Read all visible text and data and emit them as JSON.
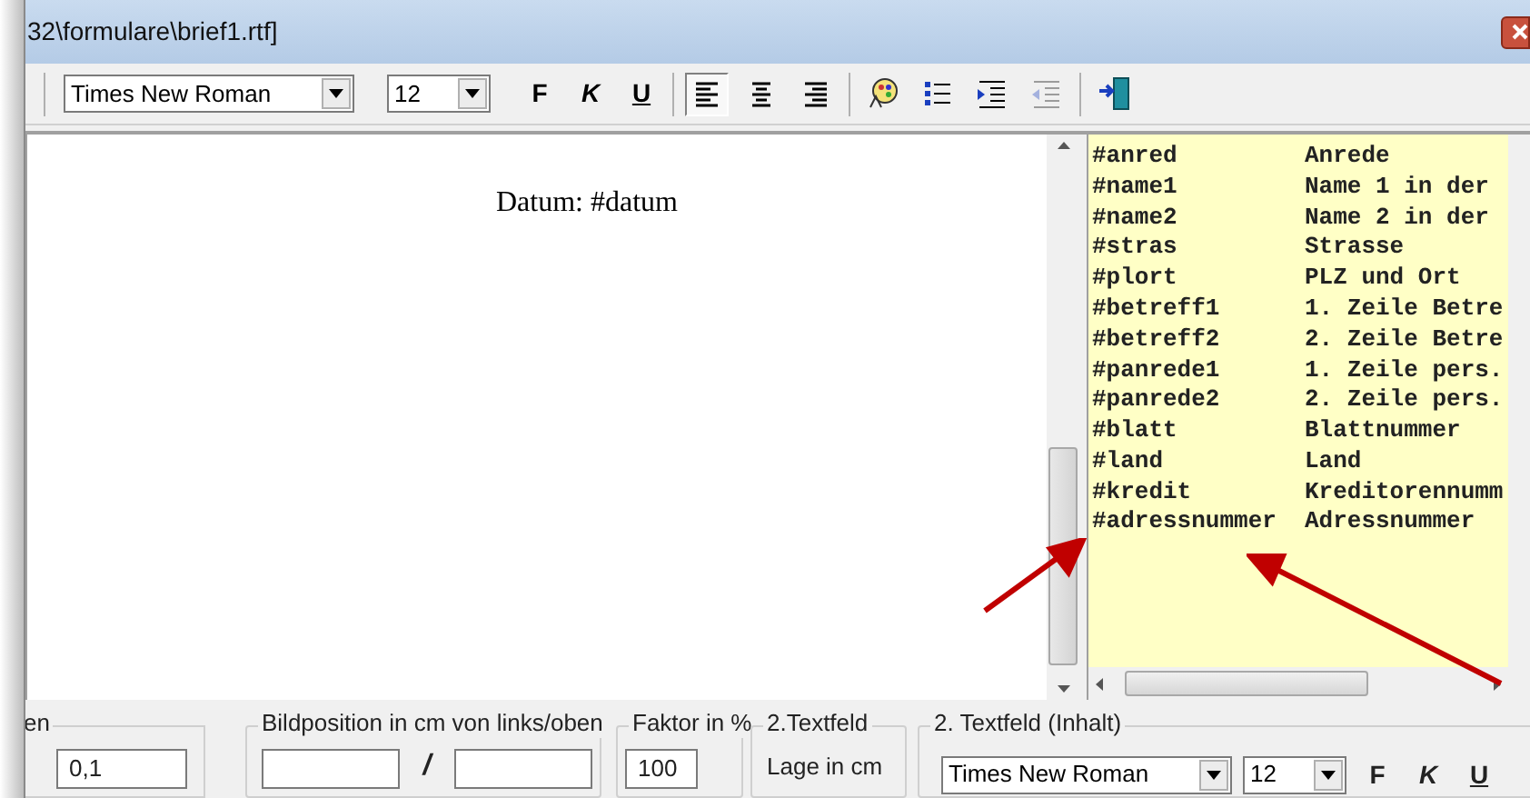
{
  "window": {
    "title": "32\\formulare\\brief1.rtf]"
  },
  "toolbar": {
    "font": "Times New Roman",
    "size": "12",
    "style_buttons": [
      {
        "label": "F",
        "kind": "bold"
      },
      {
        "label": "K",
        "kind": "italic"
      },
      {
        "label": "U",
        "kind": "underline"
      }
    ],
    "align_buttons": [
      {
        "kind": "left",
        "selected": true
      },
      {
        "kind": "center",
        "selected": false
      },
      {
        "kind": "right",
        "selected": false
      }
    ],
    "tools": [
      {
        "kind": "palette",
        "disabled": false
      },
      {
        "kind": "bullets",
        "disabled": false
      },
      {
        "kind": "indent",
        "disabled": false
      },
      {
        "kind": "outdent",
        "disabled": true
      },
      {
        "kind": "exit",
        "disabled": false
      }
    ]
  },
  "editor": {
    "text": "Datum: #datum"
  },
  "variables": [
    {
      "name": "#anred",
      "description": "Anrede"
    },
    {
      "name": "#name1",
      "description": "Name 1 in der"
    },
    {
      "name": "#name2",
      "description": "Name 2 in der"
    },
    {
      "name": "#stras",
      "description": "Strasse"
    },
    {
      "name": "#plort",
      "description": "PLZ und Ort"
    },
    {
      "name": "#betreff1",
      "description": "1. Zeile Betre"
    },
    {
      "name": "#betreff2",
      "description": "2. Zeile Betre"
    },
    {
      "name": "#panrede1",
      "description": "1. Zeile pers."
    },
    {
      "name": "#panrede2",
      "description": "2. Zeile pers."
    },
    {
      "name": "#blatt",
      "description": "Blattnummer"
    },
    {
      "name": "#land",
      "description": "Land"
    },
    {
      "name": "#kredit",
      "description": "Kreditorennumm"
    },
    {
      "name": "#adressnummer",
      "description": "Adressnummer"
    }
  ],
  "bottom": {
    "group_1": {
      "label": "en",
      "value": "0,1"
    },
    "image_position": {
      "label": "Bildposition in cm von links/oben",
      "separator": "/"
    },
    "factor": {
      "label": "Faktor in %",
      "value": "100"
    },
    "textfield_2": {
      "label": "2.Textfeld",
      "text": "Lage in cm"
    },
    "textfield_2_content": {
      "label": "2. Textfeld (Inhalt)",
      "font": "Times New Roman",
      "size": "12",
      "style_buttons": [
        {
          "label": "F",
          "kind": "bold"
        },
        {
          "label": "K",
          "kind": "italic"
        },
        {
          "label": "U",
          "kind": "underline"
        }
      ]
    }
  }
}
